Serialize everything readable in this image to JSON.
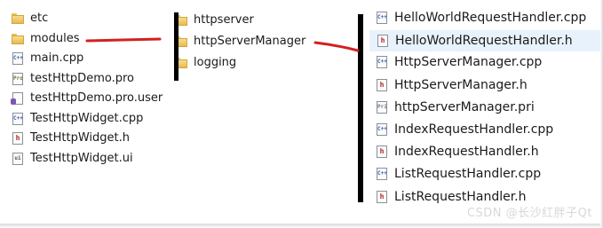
{
  "left_pane": {
    "items": [
      {
        "label": "etc",
        "icon": "folder-icon",
        "type": "folder"
      },
      {
        "label": "modules",
        "icon": "folder-icon",
        "type": "folder"
      },
      {
        "label": "main.cpp",
        "icon": "cpp-file-icon",
        "type": "cpp",
        "glyph": "C++"
      },
      {
        "label": "testHttpDemo.pro",
        "icon": "qt-pro-file-icon",
        "type": "pro",
        "glyph": "Pro"
      },
      {
        "label": "testHttpDemo.pro.user",
        "icon": "qt-user-file-icon",
        "type": "prouser",
        "glyph": ""
      },
      {
        "label": "TestHttpWidget.cpp",
        "icon": "cpp-file-icon",
        "type": "cpp",
        "glyph": "C++"
      },
      {
        "label": "TestHttpWidget.h",
        "icon": "header-file-icon",
        "type": "hdr",
        "glyph": "h"
      },
      {
        "label": "TestHttpWidget.ui",
        "icon": "ui-file-icon",
        "type": "ui",
        "glyph": "ui"
      }
    ]
  },
  "mid_pane": {
    "items": [
      {
        "label": "httpserver",
        "icon": "folder-icon",
        "type": "folder"
      },
      {
        "label": "httpServerManager",
        "icon": "folder-icon",
        "type": "folder"
      },
      {
        "label": "logging",
        "icon": "folder-icon",
        "type": "folder"
      }
    ]
  },
  "right_pane": {
    "selected_index": 1,
    "items": [
      {
        "label": "HelloWorldRequestHandler.cpp",
        "icon": "cpp-file-icon",
        "type": "cpp",
        "glyph": "C++"
      },
      {
        "label": "HelloWorldRequestHandler.h",
        "icon": "header-file-icon",
        "type": "hdr",
        "glyph": "h"
      },
      {
        "label": "HttpServerManager.cpp",
        "icon": "cpp-file-icon",
        "type": "cpp",
        "glyph": "C++"
      },
      {
        "label": "HttpServerManager.h",
        "icon": "header-file-icon",
        "type": "hdr",
        "glyph": "h"
      },
      {
        "label": "httpServerManager.pri",
        "icon": "qt-pri-file-icon",
        "type": "pri",
        "glyph": "Pri"
      },
      {
        "label": "IndexRequestHandler.cpp",
        "icon": "cpp-file-icon",
        "type": "cpp",
        "glyph": "C++"
      },
      {
        "label": "IndexRequestHandler.h",
        "icon": "header-file-icon",
        "type": "hdr",
        "glyph": "h"
      },
      {
        "label": "ListRequestHandler.cpp",
        "icon": "cpp-file-icon",
        "type": "cpp",
        "glyph": "C++"
      },
      {
        "label": "ListRequestHandler.h",
        "icon": "header-file-icon",
        "type": "hdr",
        "glyph": "h"
      }
    ]
  },
  "annotations": {
    "marker_color": "#000000",
    "arrow_color": "#d42020"
  },
  "watermark": "CSDN @长沙红胖子Qt"
}
